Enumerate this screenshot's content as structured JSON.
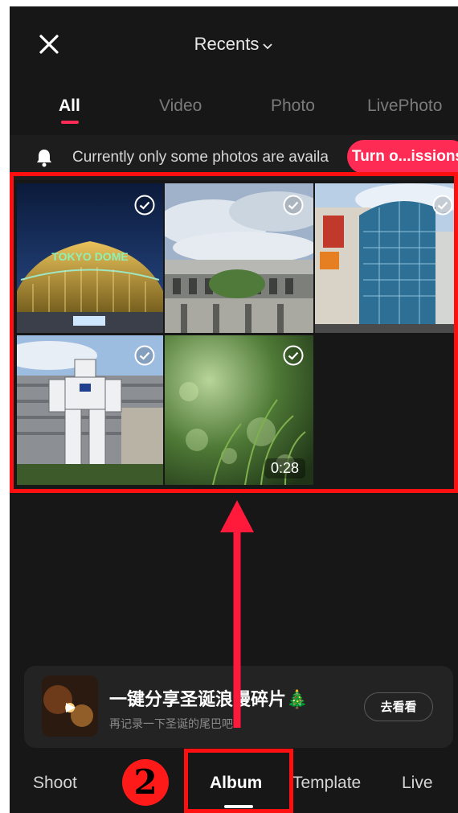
{
  "header": {
    "close_icon": "close-icon",
    "title": "Recents",
    "chevron": "⌄"
  },
  "tabs": [
    {
      "label": "All",
      "active": true
    },
    {
      "label": "Video",
      "active": false
    },
    {
      "label": "Photo",
      "active": false
    },
    {
      "label": "LivePhoto",
      "active": false
    }
  ],
  "notice": {
    "icon": "bell-icon",
    "text": "Currently only some photos are availa",
    "button_label": "Turn o...issions"
  },
  "media": [
    {
      "name": "Tokyo Dome",
      "sign_text": "TOKYO DOME",
      "selected": true
    },
    {
      "name": "Stadium",
      "selected": true
    },
    {
      "name": "Building",
      "selected": true
    },
    {
      "name": "Gundam statue",
      "selected": true
    },
    {
      "name": "Grass video",
      "selected": true,
      "duration": "0:28"
    }
  ],
  "promo": {
    "title": "一键分享圣诞浪漫碎片",
    "emoji": "🎄",
    "subtitle": "再记录一下圣诞的尾巴吧~",
    "button_label": "去看看"
  },
  "bottom_nav": [
    {
      "label": "Shoot",
      "active": false
    },
    {
      "label": "Album",
      "active": true
    },
    {
      "label": "Template",
      "active": false
    },
    {
      "label": "Live",
      "active": false
    }
  ],
  "annotation": {
    "step_number": "2",
    "color": "#ff1010"
  },
  "colors": {
    "accent": "#fe2c55",
    "background": "#171717"
  }
}
